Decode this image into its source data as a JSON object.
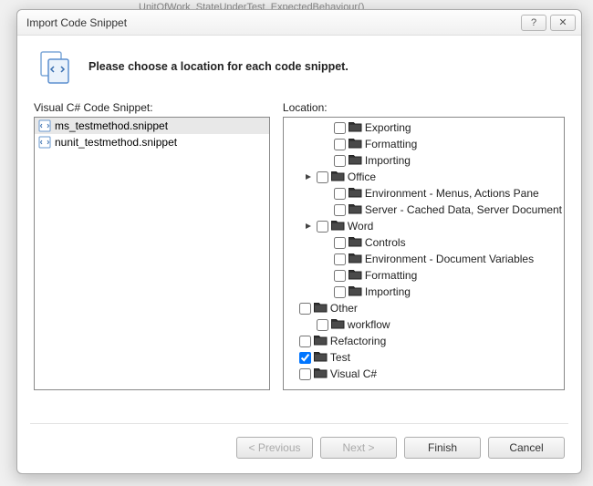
{
  "background_fragment": "UnitOfWork_StateUnderTest_ExpectedBehaviour()",
  "dialog": {
    "title": "Import Code Snippet",
    "prompt": "Please choose a location for each code snippet.",
    "help_symbol": "?",
    "close_symbol": "✕"
  },
  "left": {
    "label": "Visual C# Code Snippet:",
    "items": [
      {
        "name": "ms_testmethod.snippet",
        "selected": true
      },
      {
        "name": "nunit_testmethod.snippet",
        "selected": false
      }
    ]
  },
  "right": {
    "label": "Location:",
    "tree": [
      {
        "depth": 2,
        "exp": null,
        "checked": false,
        "label": "Exporting"
      },
      {
        "depth": 2,
        "exp": null,
        "checked": false,
        "label": "Formatting"
      },
      {
        "depth": 2,
        "exp": null,
        "checked": false,
        "label": "Importing"
      },
      {
        "depth": 1,
        "exp": "open",
        "checked": false,
        "label": "Office"
      },
      {
        "depth": 2,
        "exp": null,
        "checked": false,
        "label": "Environment - Menus, Actions Pane"
      },
      {
        "depth": 2,
        "exp": null,
        "checked": false,
        "label": "Server - Cached Data, Server Document"
      },
      {
        "depth": 1,
        "exp": "open",
        "checked": false,
        "label": "Word"
      },
      {
        "depth": 2,
        "exp": null,
        "checked": false,
        "label": "Controls"
      },
      {
        "depth": 2,
        "exp": null,
        "checked": false,
        "label": "Environment - Document Variables"
      },
      {
        "depth": 2,
        "exp": null,
        "checked": false,
        "label": "Formatting"
      },
      {
        "depth": 2,
        "exp": null,
        "checked": false,
        "label": "Importing"
      },
      {
        "depth": 0,
        "exp": null,
        "checked": false,
        "label": "Other"
      },
      {
        "depth": 1,
        "exp": null,
        "checked": false,
        "label": "workflow"
      },
      {
        "depth": 0,
        "exp": null,
        "checked": false,
        "label": "Refactoring"
      },
      {
        "depth": 0,
        "exp": null,
        "checked": true,
        "label": "Test"
      },
      {
        "depth": 0,
        "exp": null,
        "checked": false,
        "label": "Visual C#"
      }
    ]
  },
  "buttons": {
    "previous": "< Previous",
    "next": "Next >",
    "finish": "Finish",
    "cancel": "Cancel"
  }
}
